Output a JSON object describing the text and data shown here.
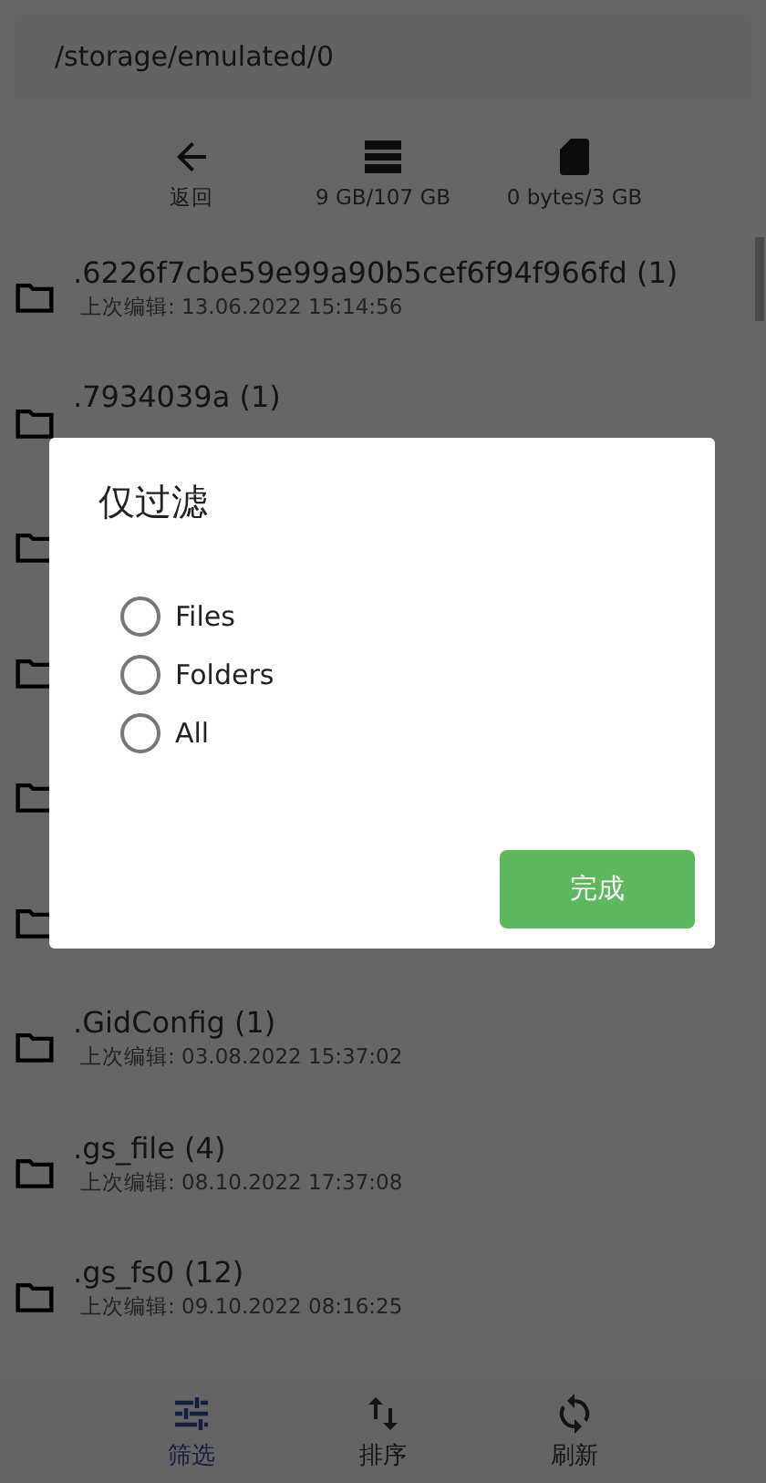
{
  "path_bar": {
    "path": "/storage/emulated/0"
  },
  "toolbar": [
    {
      "kind": "back",
      "label": "返回"
    },
    {
      "kind": "storage",
      "label": "9 GB/107 GB"
    },
    {
      "kind": "sdcard",
      "label": "0 bytes/3 GB"
    }
  ],
  "files": [
    {
      "kind": "named",
      "name": ".6226f7cbe59e99a90b5cef6f94f966fd (1)",
      "modified": "上次编辑: 13.06.2022 15:14:56"
    },
    {
      "kind": "named",
      "name": ".7934039a (1)"
    },
    {
      "kind": "covered"
    },
    {
      "kind": "covered"
    },
    {
      "kind": "covered"
    },
    {
      "kind": "covered"
    },
    {
      "kind": "named",
      "name": ".GidConfig (1)",
      "modified": "上次编辑: 03.08.2022 15:37:02"
    },
    {
      "kind": "named",
      "name": ".gs_file (4)",
      "modified": "上次编辑: 08.10.2022 17:37:08"
    },
    {
      "kind": "named",
      "name": ".gs_fs0 (12)",
      "modified": "上次编辑: 09.10.2022 08:16:25"
    }
  ],
  "dialog": {
    "title": "仅过滤",
    "options": [
      {
        "label": "Files",
        "selected": false
      },
      {
        "label": "Folders",
        "selected": false
      },
      {
        "label": "All",
        "selected": false
      }
    ],
    "button": "完成"
  },
  "bottom_nav": [
    {
      "kind": "filter",
      "label": "筛选",
      "selected": true
    },
    {
      "kind": "sort",
      "label": "排序",
      "selected": false
    },
    {
      "kind": "refresh",
      "label": "刷新",
      "selected": false
    }
  ]
}
